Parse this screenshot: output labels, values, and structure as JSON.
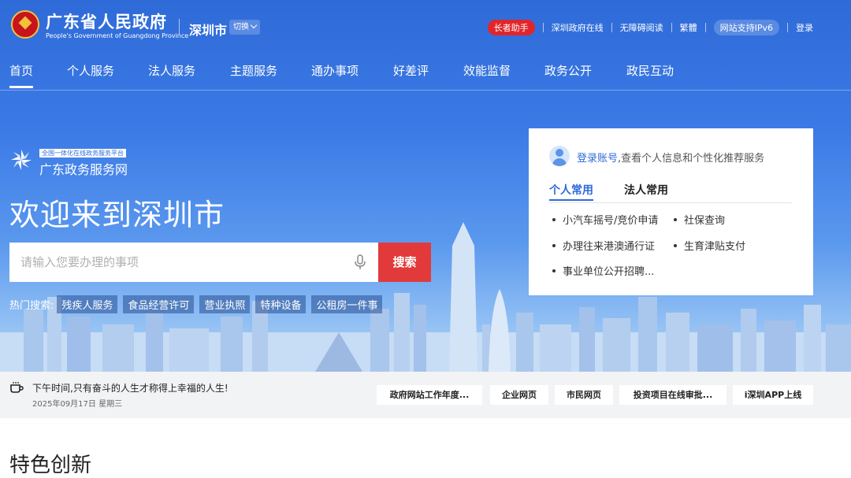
{
  "header": {
    "site_title": "广东省人民政府",
    "site_subtitle": "People's Government of Guangdong Province",
    "city": "深圳市",
    "switch_label": "切换",
    "links": {
      "elder": "长者助手",
      "online": "深圳政府在线",
      "accessible": "无障碍阅读",
      "traditional": "繁體",
      "ipv6": "网站支持IPv6",
      "login": "登录"
    }
  },
  "nav": [
    "首页",
    "个人服务",
    "法人服务",
    "主题服务",
    "通办事项",
    "好差评",
    "效能监督",
    "政务公开",
    "政民互动"
  ],
  "hero": {
    "platform_tag": "全国一体化在线政务服务平台",
    "platform_name": "广东政务服务网",
    "welcome": "欢迎来到深圳市",
    "search_placeholder": "请输入您要办理的事项",
    "search_button": "搜索",
    "hot_label": "热门搜索:",
    "hot_tags": [
      "残疾人服务",
      "食品经营许可",
      "营业执照",
      "特种设备",
      "公租房一件事"
    ]
  },
  "panel": {
    "login_link": "登录账号",
    "login_text": ",查看个人信息和个性化推荐服务",
    "tabs": [
      "个人常用",
      "法人常用"
    ],
    "services": [
      "小汽车摇号/竞价申请",
      "社保查询",
      "办理往来港澳通行证",
      "生育津贴支付",
      "事业单位公开招聘..."
    ]
  },
  "strip": {
    "motto": "下午时间,只有奋斗的人生才称得上幸福的人生!",
    "date": "2025年09月17日 星期三",
    "quick_links": [
      "政府网站工作年度...",
      "企业网页",
      "市民网页",
      "投资项目在线审批...",
      "i深圳APP上线"
    ]
  },
  "section": {
    "title": "特色创新"
  },
  "colors": {
    "primary": "#2f6bd8",
    "search_button": "#e23a3a",
    "elder_badge": "#e0262b"
  }
}
